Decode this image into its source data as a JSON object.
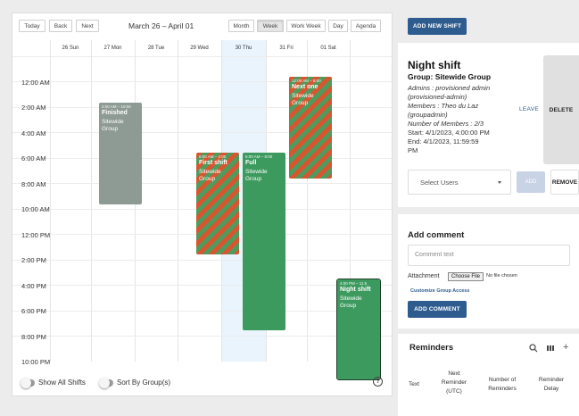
{
  "toolbar": {
    "today": "Today",
    "back": "Back",
    "next": "Next",
    "range": "March 26 – April 01",
    "views": [
      "Month",
      "Week",
      "Work Week",
      "Day",
      "Agenda"
    ],
    "active_view": "Week"
  },
  "columns": [
    "26 Sun",
    "27 Mon",
    "28 Tue",
    "29 Wed",
    "30 Thu",
    "31 Fri",
    "01 Sat"
  ],
  "times": [
    "12:00 AM",
    "2:00 AM",
    "4:00 AM",
    "6:00 AM",
    "8:00 AM",
    "10:00 AM",
    "12:00 PM",
    "2:00 PM",
    "4:00 PM",
    "6:00 PM",
    "8:00 PM",
    "10:00 PM"
  ],
  "events": [
    {
      "time": "2:00 AM – 10:00",
      "name": "Finished",
      "group": "Sitewide Group"
    },
    {
      "time": "6:00 AM – 2:00",
      "name": "First shift",
      "group": "Sitewide Group"
    },
    {
      "time": "6:00 AM – 8:00",
      "name": "Full",
      "group": "Sitewide Group"
    },
    {
      "time": "12:00 AM – 8:00",
      "name": "Next one",
      "group": "Sitewide Group"
    },
    {
      "time": "4:00 PM – 11:5",
      "name": "Night shift",
      "group": "Sitewide Group"
    }
  ],
  "footer": {
    "show_all": "Show All Shifts",
    "sort_by": "Sort By Group(s)"
  },
  "sidebar": {
    "add_shift": "ADD NEW SHIFT",
    "shift": {
      "title": "Night shift",
      "group": "Group: Sitewide Group",
      "admins": "Admins : provisioned admin",
      "admins_2": "(provisioned-admin)",
      "members": "Members : Theo du Laz",
      "members_2": "(groupadmin)",
      "num_members": "Number of Members : 2/3",
      "start": "Start: 4/1/2023, 4:00:00 PM",
      "end": "End: 4/1/2023, 11:59:59",
      "end_2": "PM",
      "leave": "LEAVE",
      "delete": "DELETE",
      "select_users": "Select Users",
      "add": "ADD",
      "remove": "REMOVE"
    },
    "comment": {
      "title": "Add comment",
      "placeholder": "Comment text",
      "attachment": "Attachment",
      "choose_file": "Choose File",
      "no_file": "No file chosen",
      "customize": "Customize Group Access",
      "add_comment": "ADD COMMENT"
    },
    "reminders": {
      "title": "Reminders",
      "col_text": "Text",
      "col_next_1": "Next",
      "col_next_2": "Reminder",
      "col_next_3": "(UTC)",
      "col_num_1": "Number of",
      "col_num_2": "Reminders",
      "col_delay_1": "Reminder",
      "col_delay_2": "Delay"
    }
  },
  "colors": {
    "primary": "#2f5c8f",
    "event_green": "#3d9a5e",
    "event_grey": "#8e9a94",
    "stripe_red": "#d9552f",
    "today_bg": "#eaf4fd"
  }
}
